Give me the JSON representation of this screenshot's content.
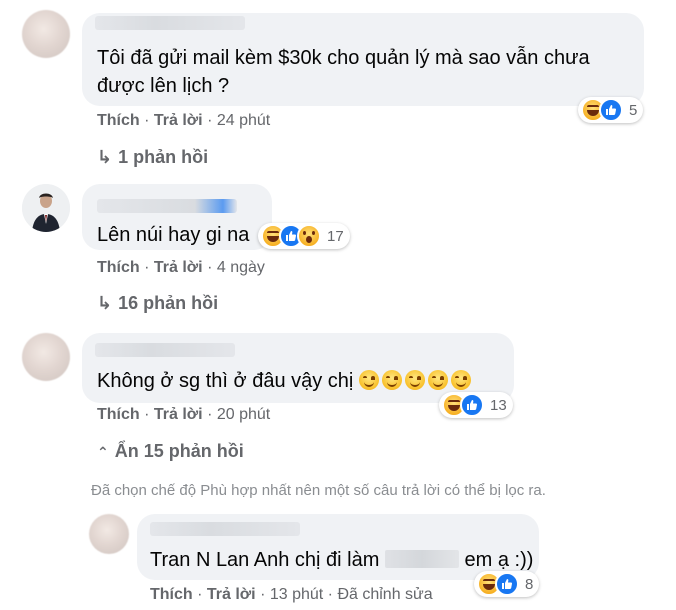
{
  "comments": [
    {
      "text_line1": "Tôi đã gửi mail kèm $30k cho quản lý mà sao vẫn chưa",
      "text_line2": "được lên lịch ?",
      "reaction_count": "5",
      "actions": {
        "like": "Thích",
        "reply": "Trả lời",
        "time": "24 phút"
      },
      "replies_label": "1 phản hồi"
    },
    {
      "text": "Lên núi hay gi na",
      "reaction_count": "17",
      "actions": {
        "like": "Thích",
        "reply": "Trả lời",
        "time": "4 ngày"
      },
      "replies_label": "16 phản hồi"
    },
    {
      "text": "Không ở sg thì ở đâu vậy chị",
      "reaction_count": "13",
      "actions": {
        "like": "Thích",
        "reply": "Trả lời",
        "time": "20 phút"
      },
      "replies_label": "Ẩn 15 phản hồi"
    }
  ],
  "filter_notice": "Đã chọn chế độ Phù hợp nhất nên một số câu trả lời có thể bị lọc ra.",
  "nested_reply": {
    "text_before": "Tran N Lan Anh chị đi làm",
    "text_after": "em ạ :))",
    "reaction_count": "8",
    "actions": {
      "like": "Thích",
      "reply": "Trả lời",
      "time": "13 phút",
      "edited": "Đã chỉnh sửa"
    }
  },
  "icons": {
    "haha": "haha-reaction-icon",
    "like": "like-reaction-icon",
    "wow": "wow-reaction-icon",
    "smile": "smiling-emoji-icon"
  },
  "colors": {
    "bubble": "#f0f2f5",
    "meta": "#65676b",
    "like_blue": "#1877f2"
  }
}
